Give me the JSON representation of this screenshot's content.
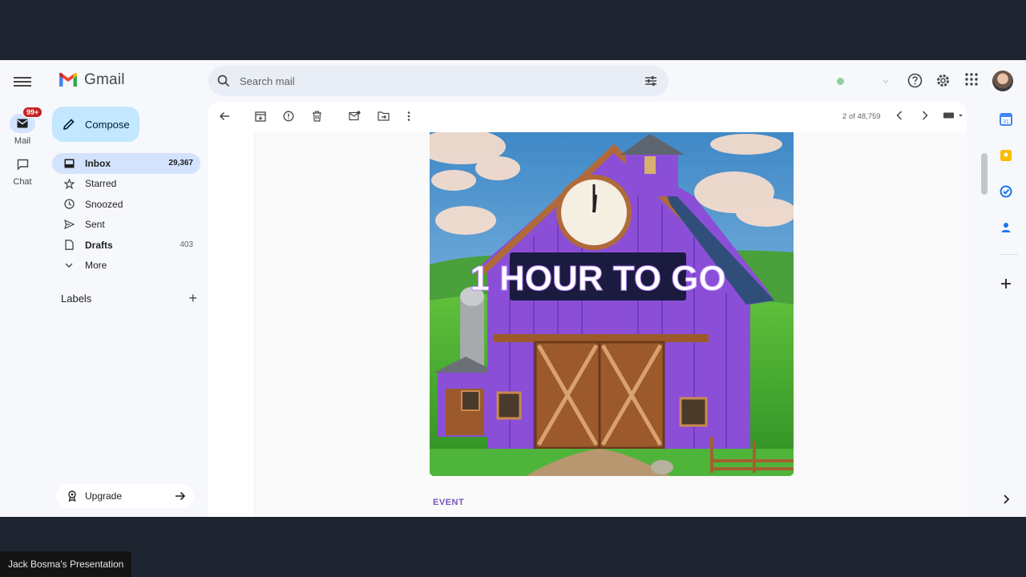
{
  "app": {
    "name": "Gmail"
  },
  "rail": {
    "mail_label": "Mail",
    "mail_badge": "99+",
    "chat_label": "Chat"
  },
  "compose": {
    "label": "Compose"
  },
  "nav": [
    {
      "label": "Inbox",
      "count": "29,367",
      "icon": "inbox-icon"
    },
    {
      "label": "Starred",
      "count": "",
      "icon": "star-icon"
    },
    {
      "label": "Snoozed",
      "count": "",
      "icon": "clock-icon"
    },
    {
      "label": "Sent",
      "count": "",
      "icon": "send-icon"
    },
    {
      "label": "Drafts",
      "count": "403",
      "icon": "draft-icon"
    },
    {
      "label": "More",
      "count": "",
      "icon": "chevron-down-icon"
    }
  ],
  "labels": {
    "title": "Labels"
  },
  "upgrade": {
    "label": "Upgrade"
  },
  "search": {
    "placeholder": "Search mail",
    "value": ""
  },
  "pager": {
    "text": "2 of 48,759"
  },
  "email": {
    "hero_text": "1 HOUR TO GO",
    "section_label": "EVENT"
  },
  "colors": {
    "accent": "#c2e7ff",
    "active_nav": "#d3e3fd",
    "barn_purple": "#8a4fd6",
    "event_purple": "#7a57b8"
  },
  "presenter": {
    "label": "Jack Bosma's Presentation"
  }
}
